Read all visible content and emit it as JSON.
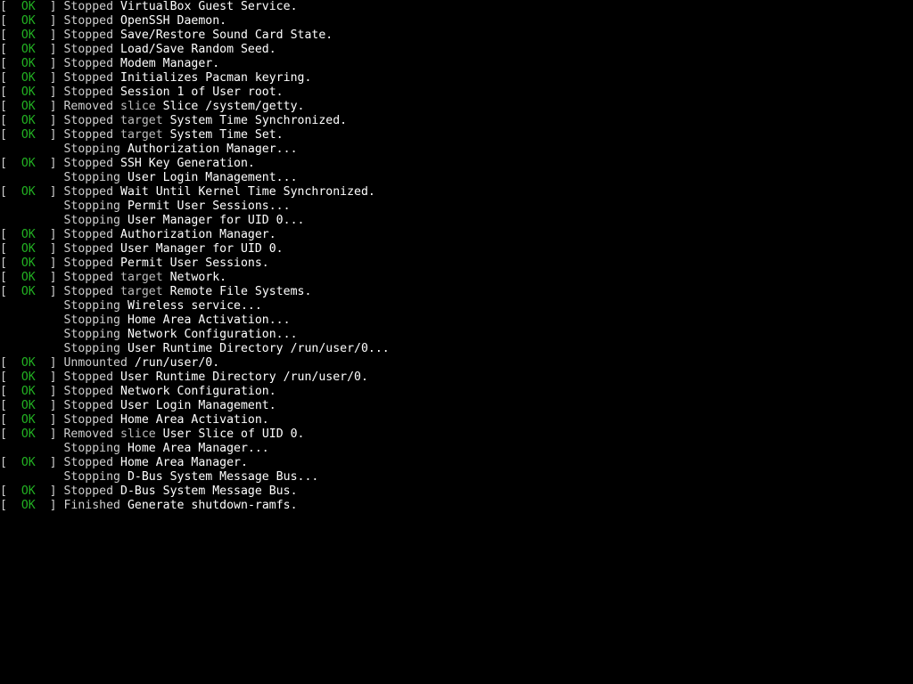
{
  "colors": {
    "background": "#000000",
    "ok": "#22b022",
    "text": "#cfcfcf",
    "highlight": "#ffffff"
  },
  "ok_label": "OK",
  "lines": [
    {
      "status": "OK",
      "verb": "Stopped",
      "kind": "",
      "desc": "VirtualBox Guest Service."
    },
    {
      "status": "OK",
      "verb": "Stopped",
      "kind": "",
      "desc": "OpenSSH Daemon."
    },
    {
      "status": "OK",
      "verb": "Stopped",
      "kind": "",
      "desc": "Save/Restore Sound Card State."
    },
    {
      "status": "OK",
      "verb": "Stopped",
      "kind": "",
      "desc": "Load/Save Random Seed."
    },
    {
      "status": "OK",
      "verb": "Stopped",
      "kind": "",
      "desc": "Modem Manager."
    },
    {
      "status": "OK",
      "verb": "Stopped",
      "kind": "",
      "desc": "Initializes Pacman keyring."
    },
    {
      "status": "OK",
      "verb": "Stopped",
      "kind": "",
      "desc": "Session 1 of User root."
    },
    {
      "status": "OK",
      "verb": "Removed",
      "kind": "slice",
      "desc": "Slice /system/getty."
    },
    {
      "status": "OK",
      "verb": "Stopped",
      "kind": "target",
      "desc": "System Time Synchronized."
    },
    {
      "status": "OK",
      "verb": "Stopped",
      "kind": "target",
      "desc": "System Time Set."
    },
    {
      "status": "",
      "verb": "Stopping",
      "kind": "",
      "desc": "Authorization Manager..."
    },
    {
      "status": "OK",
      "verb": "Stopped",
      "kind": "",
      "desc": "SSH Key Generation."
    },
    {
      "status": "",
      "verb": "Stopping",
      "kind": "",
      "desc": "User Login Management..."
    },
    {
      "status": "OK",
      "verb": "Stopped",
      "kind": "",
      "desc": "Wait Until Kernel Time Synchronized."
    },
    {
      "status": "",
      "verb": "Stopping",
      "kind": "",
      "desc": "Permit User Sessions..."
    },
    {
      "status": "",
      "verb": "Stopping",
      "kind": "",
      "desc": "User Manager for UID 0..."
    },
    {
      "status": "OK",
      "verb": "Stopped",
      "kind": "",
      "desc": "Authorization Manager."
    },
    {
      "status": "OK",
      "verb": "Stopped",
      "kind": "",
      "desc": "User Manager for UID 0."
    },
    {
      "status": "OK",
      "verb": "Stopped",
      "kind": "",
      "desc": "Permit User Sessions."
    },
    {
      "status": "OK",
      "verb": "Stopped",
      "kind": "target",
      "desc": "Network."
    },
    {
      "status": "OK",
      "verb": "Stopped",
      "kind": "target",
      "desc": "Remote File Systems."
    },
    {
      "status": "",
      "verb": "Stopping",
      "kind": "",
      "desc": "Wireless service..."
    },
    {
      "status": "",
      "verb": "Stopping",
      "kind": "",
      "desc": "Home Area Activation..."
    },
    {
      "status": "",
      "verb": "Stopping",
      "kind": "",
      "desc": "Network Configuration..."
    },
    {
      "status": "",
      "verb": "Stopping",
      "kind": "",
      "desc": "User Runtime Directory /run/user/0..."
    },
    {
      "status": "OK",
      "verb": "Unmounted",
      "kind": "",
      "desc": "/run/user/0."
    },
    {
      "status": "OK",
      "verb": "Stopped",
      "kind": "",
      "desc": "User Runtime Directory /run/user/0."
    },
    {
      "status": "OK",
      "verb": "Stopped",
      "kind": "",
      "desc": "Network Configuration."
    },
    {
      "status": "OK",
      "verb": "Stopped",
      "kind": "",
      "desc": "User Login Management."
    },
    {
      "status": "OK",
      "verb": "Stopped",
      "kind": "",
      "desc": "Home Area Activation."
    },
    {
      "status": "OK",
      "verb": "Removed",
      "kind": "slice",
      "desc": "User Slice of UID 0."
    },
    {
      "status": "",
      "verb": "Stopping",
      "kind": "",
      "desc": "Home Area Manager..."
    },
    {
      "status": "OK",
      "verb": "Stopped",
      "kind": "",
      "desc": "Home Area Manager."
    },
    {
      "status": "",
      "verb": "Stopping",
      "kind": "",
      "desc": "D-Bus System Message Bus..."
    },
    {
      "status": "OK",
      "verb": "Stopped",
      "kind": "",
      "desc": "D-Bus System Message Bus."
    },
    {
      "status": "OK",
      "verb": "Finished",
      "kind": "",
      "desc": "Generate shutdown-ramfs."
    }
  ]
}
